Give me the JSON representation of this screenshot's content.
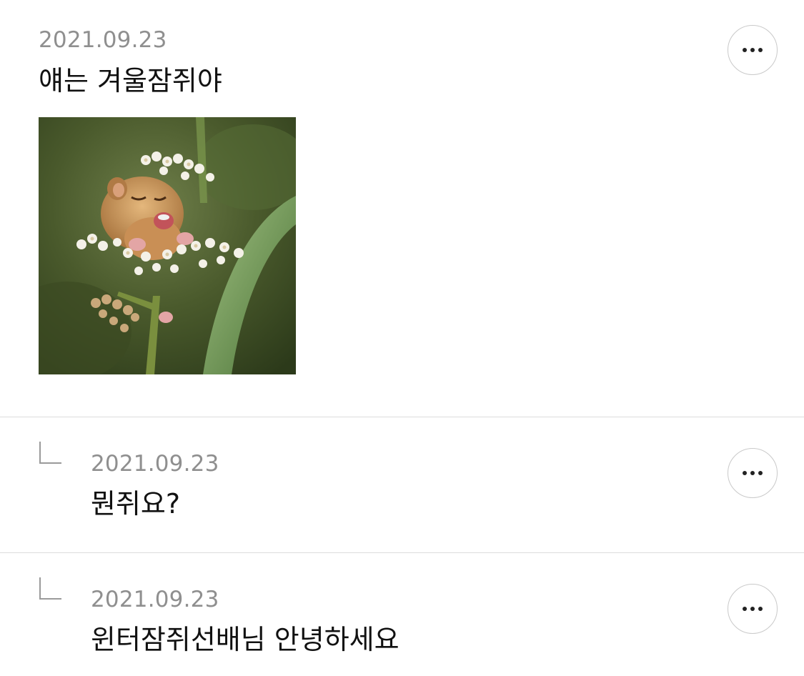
{
  "comments": [
    {
      "date": "2021.09.23",
      "text": "얘는 겨울잠쥐야",
      "has_image": true,
      "image_subject": "dormouse laughing on white yarrow flowers",
      "more_icon": "more-horizontal-icon"
    },
    {
      "date": "2021.09.23",
      "text": "뭔쥐요?",
      "is_reply": true,
      "reply_icon": "reply-arrow-icon",
      "more_icon": "more-horizontal-icon"
    },
    {
      "date": "2021.09.23",
      "text": "윈터잠쥐선배님 안녕하세요",
      "is_reply": true,
      "reply_icon": "reply-arrow-icon",
      "more_icon": "more-horizontal-icon"
    }
  ],
  "colors": {
    "date_text": "#8f8f8f",
    "body_text": "#111111",
    "divider": "#dcdcdc",
    "button_border": "#c9c9c9"
  }
}
